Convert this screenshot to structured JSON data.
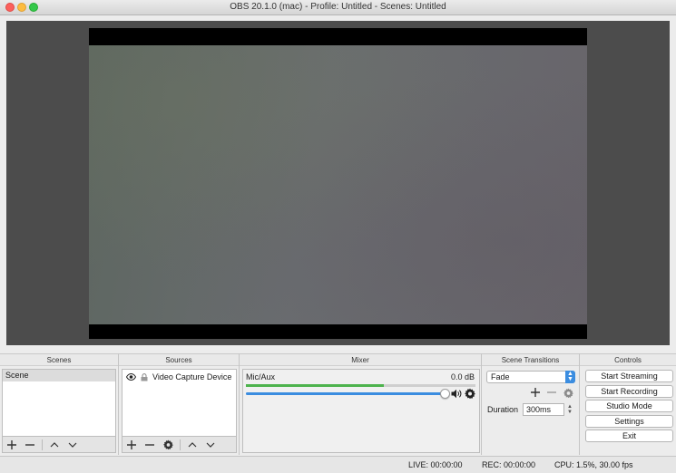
{
  "window": {
    "title": "OBS 20.1.0 (mac) - Profile: Untitled - Scenes: Untitled"
  },
  "scenes": {
    "header": "Scenes",
    "items": [
      {
        "label": "Scene",
        "selected": true
      }
    ]
  },
  "sources": {
    "header": "Sources",
    "items": [
      {
        "label": "Video Capture Device"
      }
    ]
  },
  "mixer": {
    "header": "Mixer",
    "channel": {
      "name": "Mic/Aux",
      "db": "0.0 dB",
      "level": 0.6,
      "volume": 1.0
    }
  },
  "transitions": {
    "header": "Scene Transitions",
    "selected": "Fade",
    "duration_label": "Duration",
    "duration_value": "300ms"
  },
  "controls": {
    "header": "Controls",
    "start_streaming": "Start Streaming",
    "start_recording": "Start Recording",
    "studio_mode": "Studio Mode",
    "settings": "Settings",
    "exit": "Exit"
  },
  "status": {
    "live": "LIVE: 00:00:00",
    "rec": "REC: 00:00:00",
    "cpu": "CPU: 1.5%, 30.00 fps"
  },
  "icons": {
    "add": "plus-icon",
    "remove": "minus-icon",
    "move_up": "chevron-up-icon",
    "move_down": "chevron-down-icon",
    "settings": "gear-icon",
    "visibility": "eye-icon",
    "lock": "lock-icon",
    "speaker": "speaker-icon"
  },
  "colors": {
    "accent": "#3b8de0",
    "meter": "#4db34d",
    "preview_bg": "#4c4c4c"
  }
}
